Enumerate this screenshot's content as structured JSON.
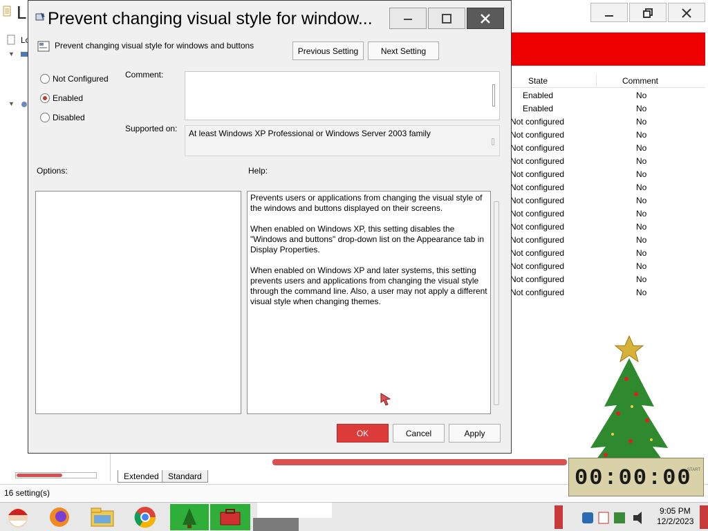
{
  "background": {
    "title": "L",
    "table": {
      "headers": {
        "state": "State",
        "comment": "Comment"
      },
      "rows": [
        {
          "state": "Enabled",
          "comment": "No"
        },
        {
          "state": "Enabled",
          "comment": "No"
        },
        {
          "state": "Not configured",
          "comment": "No"
        },
        {
          "state": "Not configured",
          "comment": "No"
        },
        {
          "state": "Not configured",
          "comment": "No"
        },
        {
          "state": "Not configured",
          "comment": "No"
        },
        {
          "state": "Not configured",
          "comment": "No"
        },
        {
          "state": "Not configured",
          "comment": "No"
        },
        {
          "state": "Not configured",
          "comment": "No"
        },
        {
          "state": "Not configured",
          "comment": "No"
        },
        {
          "state": "Not configured",
          "comment": "No"
        },
        {
          "state": "Not configured",
          "comment": "No"
        },
        {
          "state": "Not configured",
          "comment": "No"
        },
        {
          "state": "Not configured",
          "comment": "No"
        },
        {
          "state": "Not configured",
          "comment": "No"
        },
        {
          "state": "Not configured",
          "comment": "No"
        }
      ]
    },
    "tree_label": "Lo",
    "tabs": {
      "extended": "Extended",
      "standard": "Standard"
    },
    "status": "16 setting(s)",
    "banner_color": "#ee0000"
  },
  "dialog": {
    "title": "Prevent changing visual style for window...",
    "setting_name": "Prevent changing visual style for windows and buttons",
    "buttons": {
      "previous": "Previous Setting",
      "next": "Next Setting",
      "ok": "OK",
      "cancel": "Cancel",
      "apply": "Apply"
    },
    "radios": {
      "not_configured": "Not Configured",
      "enabled": "Enabled",
      "disabled": "Disabled",
      "selected": "enabled"
    },
    "comment_label": "Comment:",
    "comment_value": "",
    "supported_label": "Supported on:",
    "supported_value": "At least Windows XP Professional or Windows Server 2003 family",
    "options_label": "Options:",
    "help_label": "Help:",
    "help_paragraphs": [
      "Prevents users or applications from changing the visual style of the windows and buttons displayed on their screens.",
      "When enabled on Windows XP, this setting disables the \"Windows and buttons\" drop-down list on the Appearance tab in Display Properties.",
      "When enabled on Windows XP and later systems, this setting prevents users and applications from changing the visual style through the command line.  Also, a user may not apply a different visual style when changing themes."
    ],
    "ok_color": "#dd3a3a"
  },
  "taskbar": {
    "time": "9:05 PM",
    "date": "12/2/2023",
    "icons": [
      "santa-start-icon",
      "firefox-icon",
      "file-explorer-icon",
      "chrome-icon",
      "christmas-tree-app-icon",
      "toolbox-app-icon"
    ]
  }
}
